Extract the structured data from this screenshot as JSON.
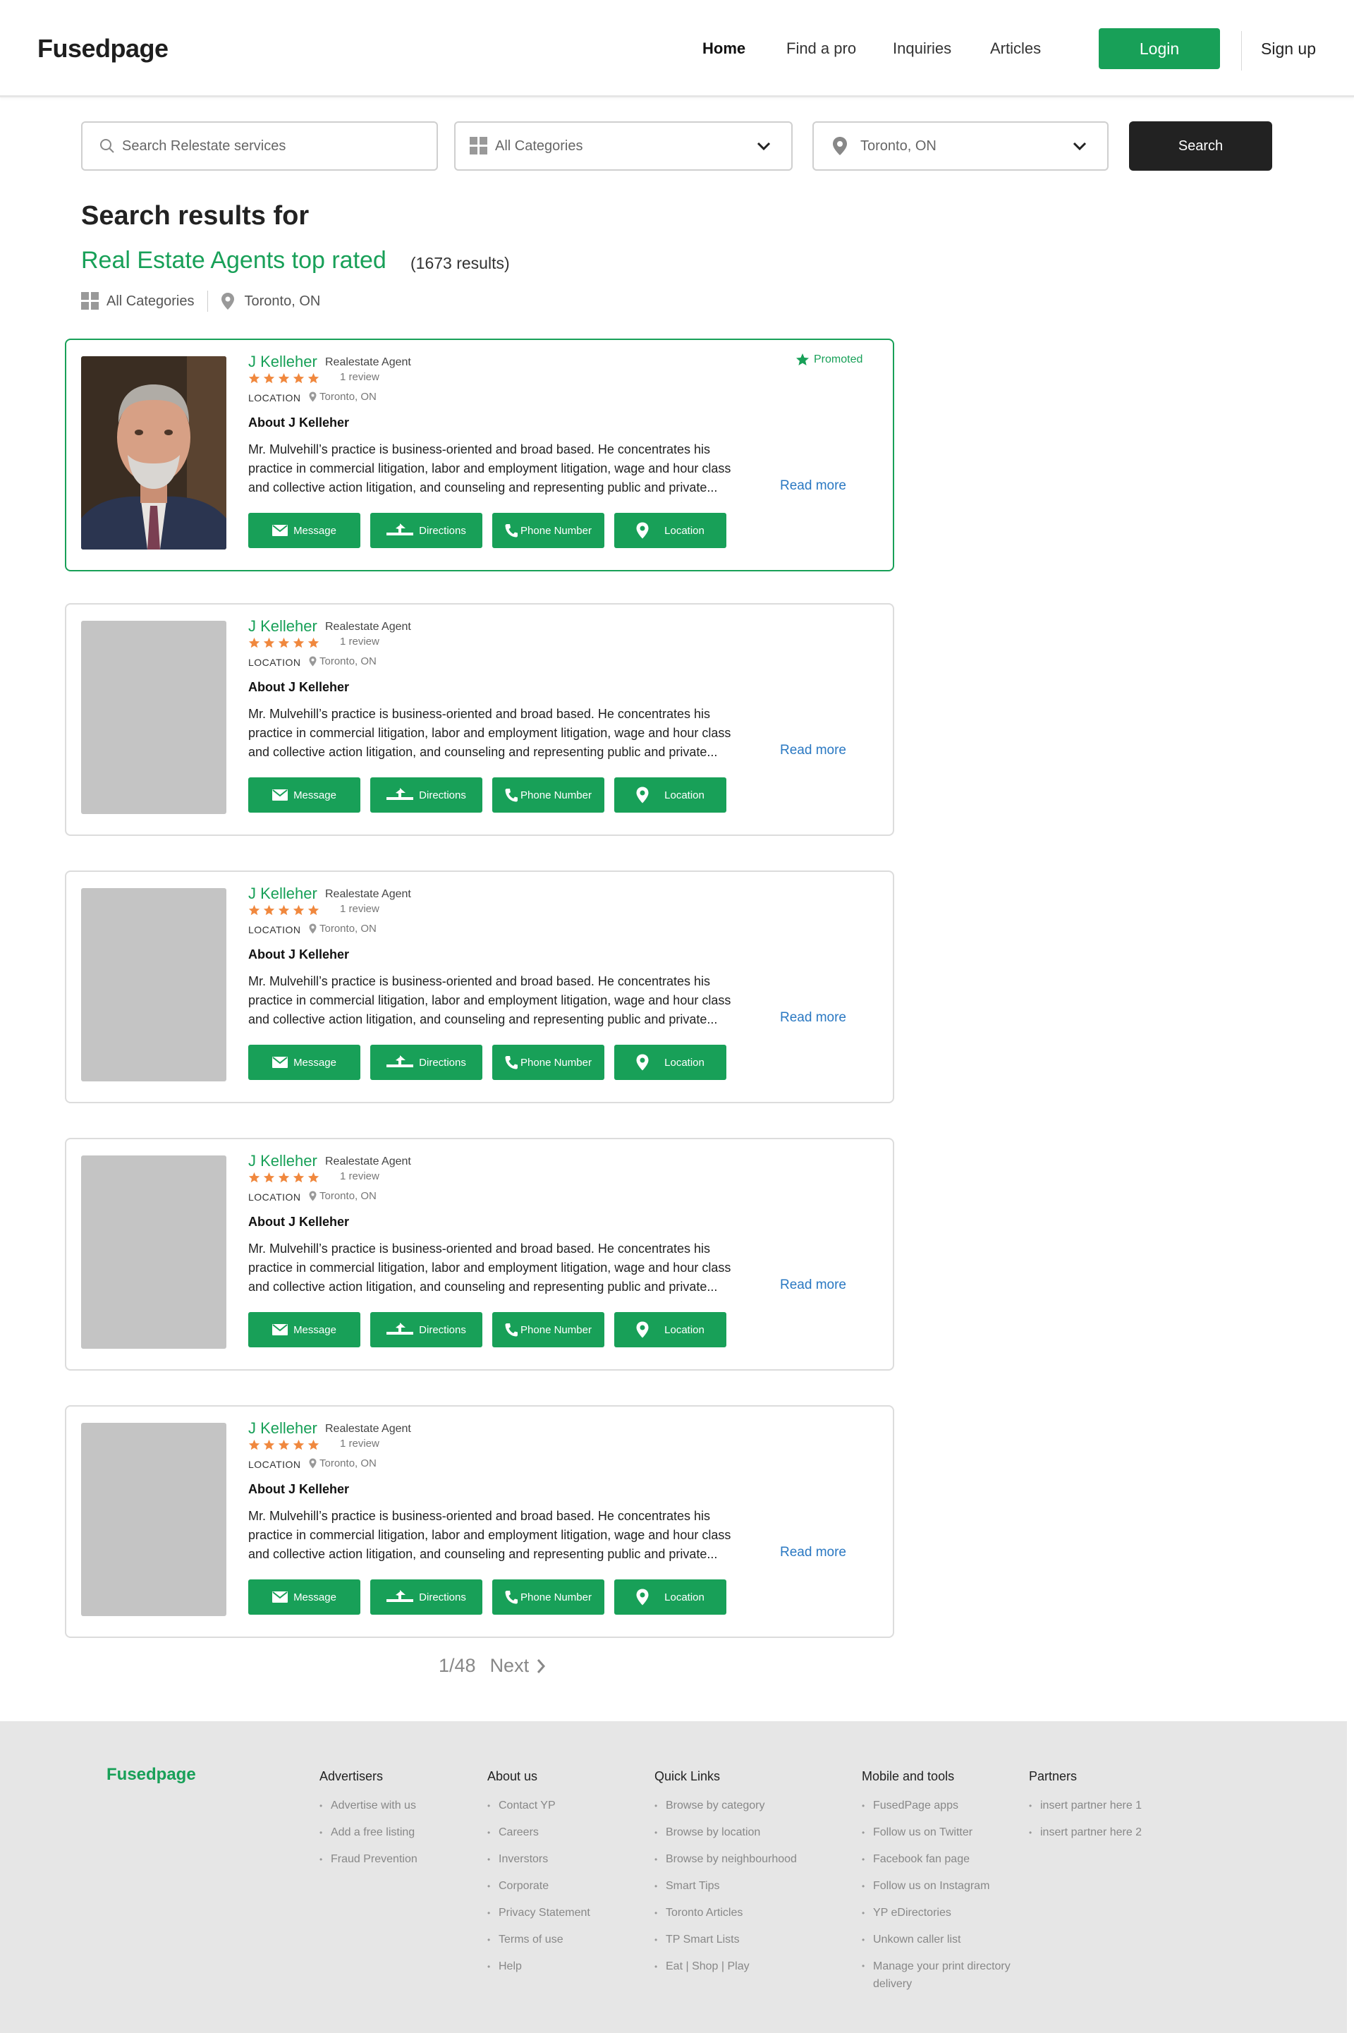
{
  "header": {
    "logo": "Fusedpage",
    "nav": [
      {
        "label": "Home",
        "active": true
      },
      {
        "label": "Find a pro",
        "active": false
      },
      {
        "label": "Inquiries",
        "active": false
      },
      {
        "label": "Articles",
        "active": false
      }
    ],
    "login_label": "Login",
    "signup_label": "Sign up"
  },
  "search": {
    "query_placeholder": "Search Relestate services",
    "category_value": "All Categories",
    "location_value": "Toronto, ON",
    "button_label": "Search"
  },
  "results": {
    "heading": "Search results for",
    "query": "Real Estate Agents top rated",
    "count": "(1673 results)",
    "filter_category": "All Categories",
    "filter_location": "Toronto, ON"
  },
  "cards": [
    {
      "name": "J Kelleher",
      "role": "Realestate Agent",
      "rating": 5,
      "reviews": "1 review",
      "location_label": "LOCATION",
      "location": "Toronto, ON",
      "about": "About J Kelleher",
      "desc_1": "Mr. Mulvehill’s practice is business-oriented and broad based. He concentrates his",
      "desc_2": "practice in commercial litigation, labor and employment litigation, wage and hour class",
      "desc_3": "and collective action litigation, and counseling and representing public and private...",
      "read_more": "Read more",
      "promoted": "Promoted",
      "has_photo": true
    },
    {
      "name": "J Kelleher",
      "role": "Realestate Agent",
      "rating": 5,
      "reviews": "1 review",
      "location_label": "LOCATION",
      "location": "Toronto, ON",
      "about": "About J Kelleher",
      "desc_1": "Mr. Mulvehill’s practice is business-oriented and broad based. He concentrates his",
      "desc_2": "practice in commercial litigation, labor and employment litigation, wage and hour class",
      "desc_3": "and collective action litigation, and counseling and representing public and private...",
      "read_more": "Read more",
      "has_photo": false
    },
    {
      "name": "J Kelleher",
      "role": "Realestate Agent",
      "rating": 5,
      "reviews": "1 review",
      "location_label": "LOCATION",
      "location": "Toronto, ON",
      "about": "About J Kelleher",
      "desc_1": "Mr. Mulvehill’s practice is business-oriented and broad based. He concentrates his",
      "desc_2": "practice in commercial litigation, labor and employment litigation, wage and hour class",
      "desc_3": "and collective action litigation, and counseling and representing public and private...",
      "read_more": "Read more",
      "has_photo": false
    },
    {
      "name": "J Kelleher",
      "role": "Realestate Agent",
      "rating": 5,
      "reviews": "1 review",
      "location_label": "LOCATION",
      "location": "Toronto, ON",
      "about": "About J Kelleher",
      "desc_1": "Mr. Mulvehill’s practice is business-oriented and broad based. He concentrates his",
      "desc_2": "practice in commercial litigation, labor and employment litigation, wage and hour class",
      "desc_3": "and collective action litigation, and counseling and representing public and private...",
      "read_more": "Read more",
      "has_photo": false
    },
    {
      "name": "J Kelleher",
      "role": "Realestate Agent",
      "rating": 5,
      "reviews": "1 review",
      "location_label": "LOCATION",
      "location": "Toronto, ON",
      "about": "About J Kelleher",
      "desc_1": "Mr. Mulvehill’s practice is business-oriented and broad based. He concentrates his",
      "desc_2": "practice in commercial litigation, labor and employment litigation, wage and hour class",
      "desc_3": "and collective action litigation, and counseling and representing public and private...",
      "read_more": "Read more",
      "has_photo": false
    }
  ],
  "actions": {
    "message": "Message",
    "directions": "Directions",
    "phone": "Phone Number",
    "location": "Location"
  },
  "pagination": {
    "page": "1/48",
    "next": "Next"
  },
  "footer": {
    "logo": "Fusedpage",
    "advertisers": {
      "title": "Advertisers",
      "items": [
        "Advertise with us",
        "Add a free listing",
        "Fraud Prevention"
      ]
    },
    "about": {
      "title": "About us",
      "items": [
        "Contact YP",
        "Careers",
        "Inverstors",
        "Corporate",
        "Privacy Statement",
        "Terms of use",
        "Help"
      ]
    },
    "quick": {
      "title": "Quick Links",
      "items": [
        "Browse by category",
        "Browse by location",
        "Browse by neighbourhood",
        "Smart Tips",
        "Toronto Articles",
        "TP Smart Lists",
        "Eat | Shop | Play"
      ]
    },
    "mobile": {
      "title": "Mobile and tools",
      "items": [
        "FusedPage apps",
        "Follow us on Twitter",
        "Facebook fan page",
        "Follow us on Instagram",
        "YP eDirectories",
        "Unkown caller list",
        "Manage your print directory delivery"
      ]
    },
    "partners": {
      "title": "Partners",
      "items": [
        "insert partner here 1",
        "insert partner here 2"
      ]
    }
  },
  "colors": {
    "accent": "#18a058",
    "star": "#f0883e",
    "link": "#2a78c2",
    "dark_button": "#222222",
    "footer_bg": "#e6e6e6"
  }
}
